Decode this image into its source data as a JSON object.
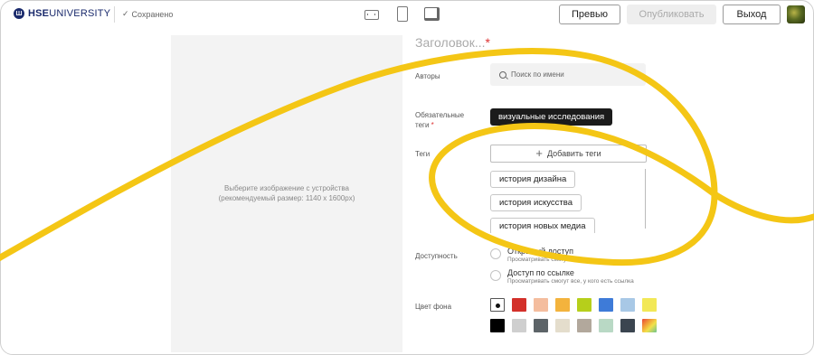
{
  "header": {
    "logo": {
      "mark": "Ш",
      "brand_bold": "HSE",
      "brand_rest": "UNIVERSITY"
    },
    "saved": {
      "check": "✓",
      "label": "Сохранено"
    },
    "device_buttons": [
      "tablet-landscape-icon",
      "tablet-portrait-icon",
      "desktop-icon"
    ],
    "preview_label": "Превью",
    "publish_label": "Опубликовать",
    "exit_label": "Выход"
  },
  "image_upload": {
    "hint_line1": "Выберите изображение с устройства",
    "hint_line2": "(рекомендуемый размер: 1140 х 1600px)"
  },
  "form": {
    "title_placeholder": "Заголовок...",
    "required_mark": "*",
    "authors": {
      "label": "Авторы",
      "search_placeholder": "Поиск по имени"
    },
    "required_tags": {
      "label_line1": "Обязательные",
      "label_line2": "теги",
      "chip": "визуальные исследования"
    },
    "tags": {
      "label": "Теги",
      "add_label": "Добавить теги",
      "items": [
        "история дизайна",
        "история искусства",
        "история новых медиа"
      ]
    },
    "access": {
      "label": "Доступность",
      "options": [
        {
          "title": "Открытый доступ",
          "subtitle": "Просматривать смогут все"
        },
        {
          "title": "Доступ по ссылке",
          "subtitle": "Просматривать смогут все, у кого есть ссылка"
        }
      ]
    },
    "background": {
      "label": "Цвет фона",
      "selected_index": 0,
      "colors_row1": [
        "#ffffff",
        "#d3302a",
        "#f4bd9e",
        "#f3b33d",
        "#b6cf1b",
        "#3e7bd8",
        "#a8c8e6",
        "#f2e857"
      ],
      "colors_row2": [
        "#000000",
        "#cfcfcf",
        "#5d6468",
        "#e4ddcc",
        "#b2a89c",
        "#b9d9c5",
        "#3b4550",
        "gradient"
      ]
    }
  },
  "colors": {
    "scribble": "#f4c615",
    "required": "#dd3333"
  }
}
